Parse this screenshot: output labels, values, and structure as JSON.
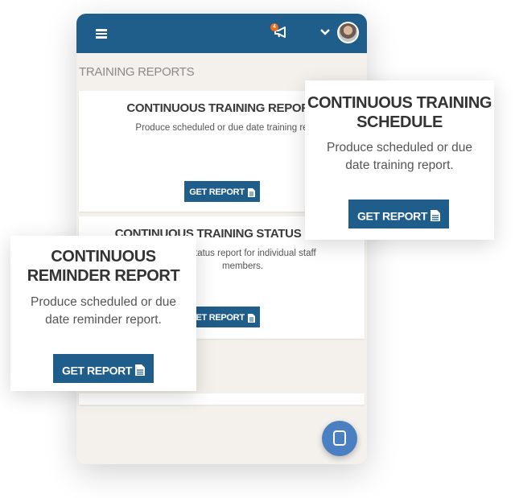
{
  "header": {
    "notification_count": "4",
    "icons": [
      "menu-icon",
      "megaphone-icon",
      "chevron-down-icon",
      "avatar"
    ]
  },
  "section_title": "TRAINING REPORTS",
  "cards": [
    {
      "title": "CONTINUOUS TRAINING REPORT",
      "description": "Produce scheduled or due date training re",
      "button_label": "GET REPORT"
    },
    {
      "title": "CONTINUOUS TRAINING STATUS REP",
      "description_line1": "tatus report for individual staff",
      "description_line2": "members.",
      "button_label": "GET REPORT"
    }
  ],
  "popups": {
    "schedule": {
      "title_line1": "CONTINUOUS TRAINING",
      "title_line2": "SCHEDULE",
      "desc_line1": "Produce scheduled or due",
      "desc_line2": "date training report.",
      "button_label": "GET REPORT"
    },
    "reminder": {
      "title_line1": "CONTINUOUS",
      "title_line2": "REMINDER REPORT",
      "desc_line1": "Produce scheduled or due",
      "desc_line2": "date reminder report.",
      "button_label": "GET REPORT"
    }
  },
  "colors": {
    "primary": "#1f5d8a",
    "badge": "#f06a1c",
    "chat": "#4a7fc1",
    "background": "#f4f1ec"
  }
}
